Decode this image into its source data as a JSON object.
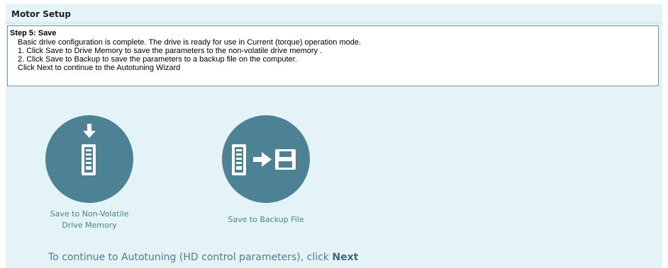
{
  "header": {
    "title": "Motor Setup"
  },
  "step": {
    "title": "Step 5: Save",
    "lines": [
      "Basic drive configuration is complete. The drive is ready for use in Current (torque) operation mode.",
      "1. Click Save to Drive Memory to save the parameters to the non-volatile drive memory .",
      "2. Click Save to Backup to save the parameters to a backup file on the computer.",
      "Click Next to continue to the Autotuning  Wizard"
    ]
  },
  "actions": {
    "save_memory": {
      "label_line1": "Save to Non-Volatile",
      "label_line2": "Drive Memory",
      "icon": "drive-download-icon"
    },
    "save_backup": {
      "label": "Save to Backup File",
      "icon": "drive-to-disk-icon"
    }
  },
  "footer": {
    "text": "To continue to Autotuning (HD control parameters), click ",
    "next_label": "Next"
  },
  "colors": {
    "header_bg": "#e6f4f9",
    "panel_bg": "#e4f3f8",
    "button_circle": "#4d8294",
    "label_text": "#4d7f91"
  }
}
